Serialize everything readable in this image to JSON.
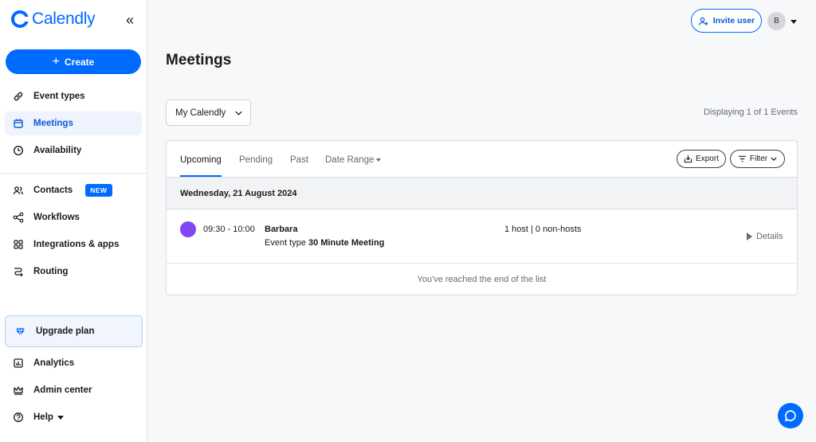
{
  "app": {
    "logo_text": "Calendly"
  },
  "sidebar": {
    "create_label": "Create",
    "primary": [
      {
        "label": "Event types",
        "icon": "link-icon"
      },
      {
        "label": "Meetings",
        "icon": "calendar-icon",
        "active": true
      },
      {
        "label": "Availability",
        "icon": "clock-icon"
      }
    ],
    "secondary": [
      {
        "label": "Contacts",
        "icon": "contacts-icon",
        "badge": "NEW"
      },
      {
        "label": "Workflows",
        "icon": "workflow-icon"
      },
      {
        "label": "Integrations & apps",
        "icon": "grid-icon"
      },
      {
        "label": "Routing",
        "icon": "routing-icon"
      }
    ],
    "upgrade_label": "Upgrade plan",
    "bottom": [
      {
        "label": "Analytics",
        "icon": "chart-icon"
      },
      {
        "label": "Admin center",
        "icon": "crown-icon"
      },
      {
        "label": "Help",
        "icon": "help-icon"
      }
    ]
  },
  "header": {
    "invite_label": "Invite user",
    "avatar_initial": "B"
  },
  "main": {
    "title": "Meetings",
    "calendar_select": "My Calendly",
    "displaying": "Displaying 1 of 1 Events",
    "tabs": [
      "Upcoming",
      "Pending",
      "Past",
      "Date Range"
    ],
    "export_label": "Export",
    "filter_label": "Filter",
    "date_heading": "Wednesday, 21 August 2024",
    "event": {
      "time": "09:30 - 10:00",
      "invitee": "Barbara",
      "type_prefix": "Event type",
      "type_name": "30 Minute Meeting",
      "hosts": "1 host | 0 non-hosts",
      "details_label": "Details",
      "color": "#8247f5"
    },
    "end_text": "You've reached the end of the list"
  },
  "colors": {
    "brand": "#006bff"
  }
}
